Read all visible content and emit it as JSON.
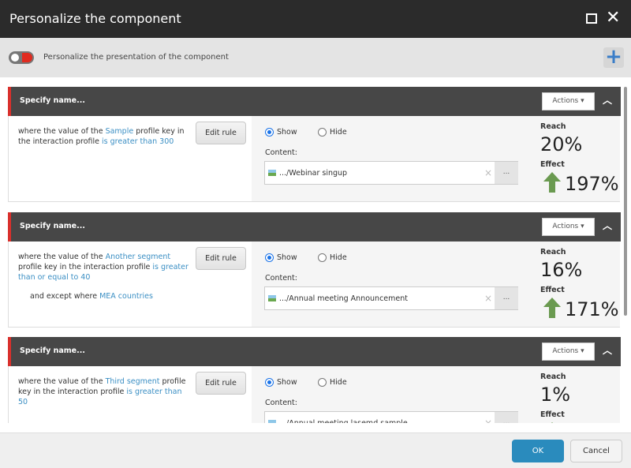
{
  "window": {
    "title": "Personalize the component",
    "maximize_icon": "square-icon",
    "close_icon": "close-icon"
  },
  "toolbar": {
    "description": "Personalize the presentation of the component",
    "add_icon": "plus-icon"
  },
  "accent": "#d9302c",
  "rules": [
    {
      "name": "Specify name...",
      "actions": "Actions",
      "rule_parts": [
        "where the value of the ",
        "Sample",
        " profile key in the interaction profile ",
        "is greater than 300"
      ],
      "except_parts": null,
      "edit": "Edit rule",
      "show": "Show",
      "hide": "Hide",
      "selected": "Show",
      "content_label": "Content:",
      "content": ".../Webinar singup",
      "reach_label": "Reach",
      "reach": "20%",
      "effect_label": "Effect",
      "effect": "197%",
      "effect_direction": "up"
    },
    {
      "name": "Specify name...",
      "actions": "Actions",
      "rule_parts": [
        "where the value of the ",
        "Another segment",
        " profile key in the interaction profile ",
        "is greater than or equal to 40"
      ],
      "except_parts": [
        "and except where ",
        "MEA countries"
      ],
      "edit": "Edit rule",
      "show": "Show",
      "hide": "Hide",
      "selected": "Show",
      "content_label": "Content:",
      "content": ".../Annual meeting Announcement",
      "reach_label": "Reach",
      "reach": "16%",
      "effect_label": "Effect",
      "effect": "171%",
      "effect_direction": "up"
    },
    {
      "name": "Specify name...",
      "actions": "Actions",
      "rule_parts": [
        "where the value of the ",
        "Third segment",
        " profile key in the interaction profile ",
        "is greater than 50"
      ],
      "except_parts": null,
      "edit": "Edit rule",
      "show": "Show",
      "hide": "Hide",
      "selected": "Show",
      "content_label": "Content:",
      "content": ".../Annual meeting lasemd sample",
      "reach_label": "Reach",
      "reach": "1%",
      "effect_label": "Effect",
      "effect": "",
      "effect_direction": "up"
    }
  ],
  "footer": {
    "ok": "OK",
    "cancel": "Cancel"
  }
}
